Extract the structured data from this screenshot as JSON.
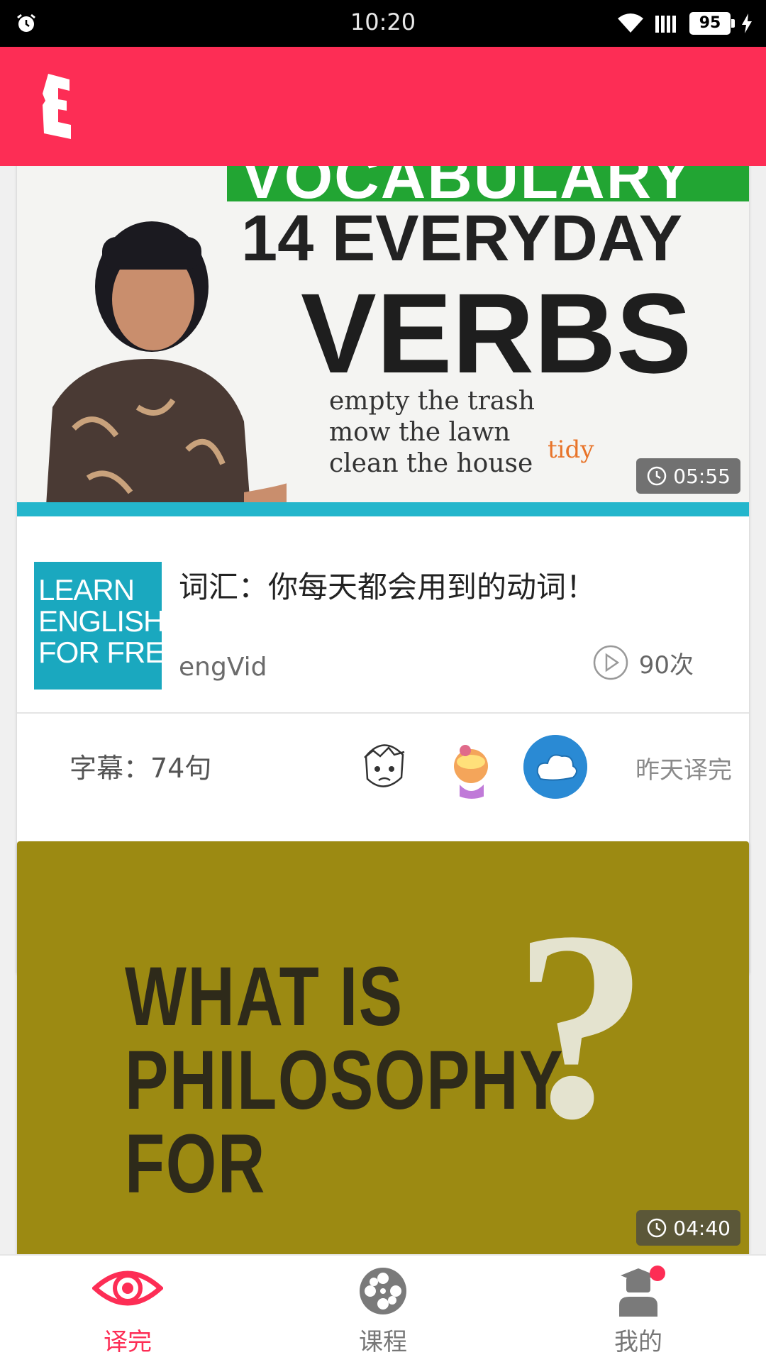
{
  "status_bar": {
    "time": "10:20",
    "battery": "95"
  },
  "colors": {
    "brand": "#fd2d55",
    "accent_bar": "#24b6cc",
    "channel_logo_bg": "#1aa8bf"
  },
  "app_bar": {
    "logo_icon": "E-logo-icon"
  },
  "feed": {
    "items": [
      {
        "thumbnail": {
          "headline": "VOCABULARY",
          "line1": "14 EVERYDAY",
          "line2": "VERBS",
          "whiteboard": [
            "empty the trash",
            "mow the lawn",
            "clean the house"
          ],
          "whiteboard_note": "tidy"
        },
        "duration": "05:55",
        "channel_logo_lines": [
          "LEARN",
          "ENGLISH",
          "FOR FREE"
        ],
        "title": "词汇：你每天都会用到的动词！",
        "channel": "engVid",
        "plays": "90次",
        "subtitles": "字幕：74句",
        "status": "昨天译完"
      },
      {
        "thumbnail": {
          "line1": "WHAT IS",
          "line2": "PHILOSOPHY FOR",
          "mark": "?"
        },
        "duration": "04:40"
      }
    ]
  },
  "bottom_nav": {
    "items": [
      {
        "label": "译完",
        "icon": "eye-icon",
        "active": true
      },
      {
        "label": "课程",
        "icon": "film-reel-icon",
        "active": false
      },
      {
        "label": "我的",
        "icon": "graduate-profile-icon",
        "active": false,
        "has_notification": true
      }
    ]
  }
}
